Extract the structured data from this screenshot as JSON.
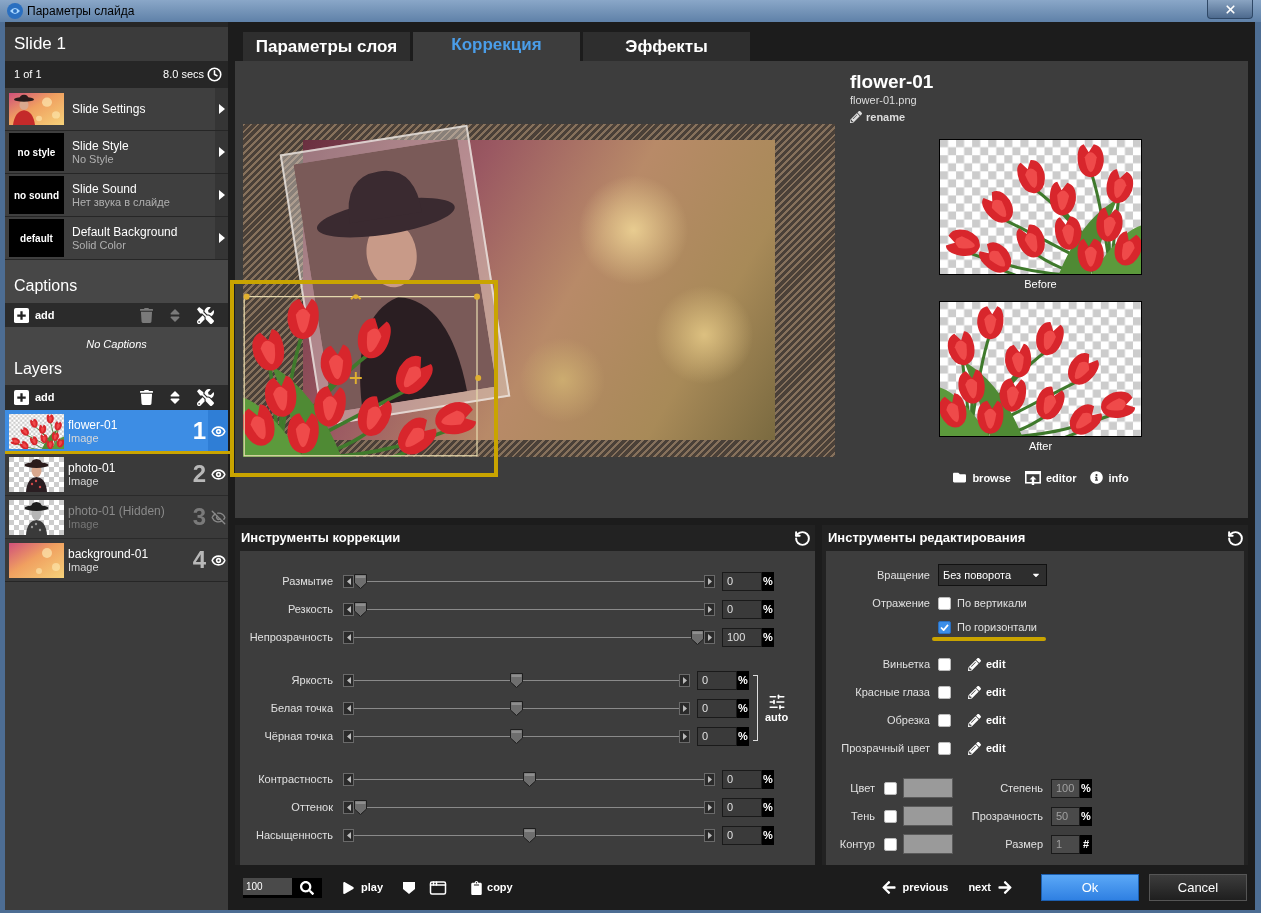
{
  "window": {
    "title": "Параметры слайда"
  },
  "sidebar": {
    "slide_title": "Slide 1",
    "position": "1 of 1",
    "duration": "8.0 secs",
    "settings": [
      {
        "kind": "photo",
        "title": "Slide Settings"
      },
      {
        "kind": "label",
        "thumb_text": "no style",
        "title": "Slide Style",
        "subtitle": "No Style"
      },
      {
        "kind": "label",
        "thumb_text": "no sound",
        "title": "Slide Sound",
        "subtitle": "Нет звука в слайде"
      },
      {
        "kind": "label",
        "thumb_text": "default",
        "title": "Default Background",
        "subtitle": "Solid Color"
      }
    ],
    "captions": {
      "heading": "Captions",
      "add": "add",
      "remove_enabled": false,
      "empty": "No Captions"
    },
    "layers": {
      "heading": "Layers",
      "add": "add",
      "remove_enabled": true,
      "items": [
        {
          "name": "flower-01",
          "type": "Image",
          "number": "1",
          "kind": "tulips",
          "selected": true,
          "visible": true
        },
        {
          "name": "photo-01",
          "type": "Image",
          "number": "2",
          "kind": "portrait",
          "selected": false,
          "visible": true
        },
        {
          "name": "photo-01 (Hidden)",
          "type": "Image",
          "number": "3",
          "kind": "portrait",
          "selected": false,
          "visible": false
        },
        {
          "name": "background-01",
          "type": "Image",
          "number": "4",
          "kind": "bokeh",
          "selected": false,
          "visible": true
        }
      ]
    }
  },
  "tabs": [
    {
      "label": "Параметры слоя",
      "selected": false
    },
    {
      "label": "Коррекция",
      "selected": true
    },
    {
      "label": "Эффекты",
      "selected": false
    }
  ],
  "layer_info": {
    "name": "flower-01",
    "file": "flower-01.png",
    "rename": "rename",
    "before": "Before",
    "after": "After",
    "actions": [
      {
        "kind": "folder",
        "label": "browse"
      },
      {
        "kind": "editor",
        "label": "editor"
      },
      {
        "kind": "info",
        "label": "info"
      }
    ]
  },
  "correction": {
    "title": "Инструменты коррекции",
    "groups": [
      {
        "sliders": [
          {
            "label": "Размытие",
            "level": 0,
            "value": "0",
            "unit": "%"
          },
          {
            "label": "Резкость",
            "level": 0,
            "value": "0",
            "unit": "%"
          },
          {
            "label": "Непрозрачность",
            "level": 1,
            "value": "100",
            "unit": "%"
          }
        ]
      },
      {
        "auto_label": "auto",
        "sliders": [
          {
            "label": "Яркость",
            "level": 0.5,
            "value": "0",
            "unit": "%"
          },
          {
            "label": "Белая точка",
            "level": 0.5,
            "value": "0",
            "unit": "%"
          },
          {
            "label": "Чёрная точка",
            "level": 0.5,
            "value": "0",
            "unit": "%"
          }
        ]
      },
      {
        "sliders": [
          {
            "label": "Контрастность",
            "level": 0.5,
            "value": "0",
            "unit": "%"
          },
          {
            "label": "Оттенок",
            "level": 0,
            "value": "0",
            "unit": "%"
          },
          {
            "label": "Насыщенность",
            "level": 0.5,
            "value": "0",
            "unit": "%"
          }
        ]
      }
    ]
  },
  "editing": {
    "title": "Инструменты редактирования",
    "rotation": {
      "label": "Вращение",
      "value": "Без поворота"
    },
    "mirror": {
      "label": "Отражение",
      "options": [
        {
          "label": "По вертикали",
          "checked": false
        },
        {
          "label": "По горизонтали",
          "checked": true
        }
      ]
    },
    "effects": [
      {
        "label": "Виньетка",
        "checked": false,
        "action": "edit"
      },
      {
        "label": "Красные глаза",
        "checked": false,
        "action": "edit"
      },
      {
        "label": "Обрезка",
        "checked": false,
        "action": "edit"
      },
      {
        "label": "Прозрачный цвет",
        "checked": false,
        "action": "edit"
      }
    ],
    "styles": [
      {
        "label": "Цвет",
        "checked": false
      },
      {
        "label": "Тень",
        "checked": false
      },
      {
        "label": "Контур",
        "checked": false
      }
    ],
    "params": [
      {
        "label": "Степень",
        "value": "100",
        "unit": "%",
        "disabled": true
      },
      {
        "label": "Прозрачность",
        "value": "50",
        "unit": "%",
        "disabled": true
      },
      {
        "label": "Размер",
        "value": "1",
        "unit": "#",
        "disabled": true
      }
    ]
  },
  "footer": {
    "zoom": "100",
    "play": "play",
    "copy": "copy",
    "previous": "previous",
    "next": "next",
    "ok": "Ok",
    "cancel": "Cancel"
  }
}
